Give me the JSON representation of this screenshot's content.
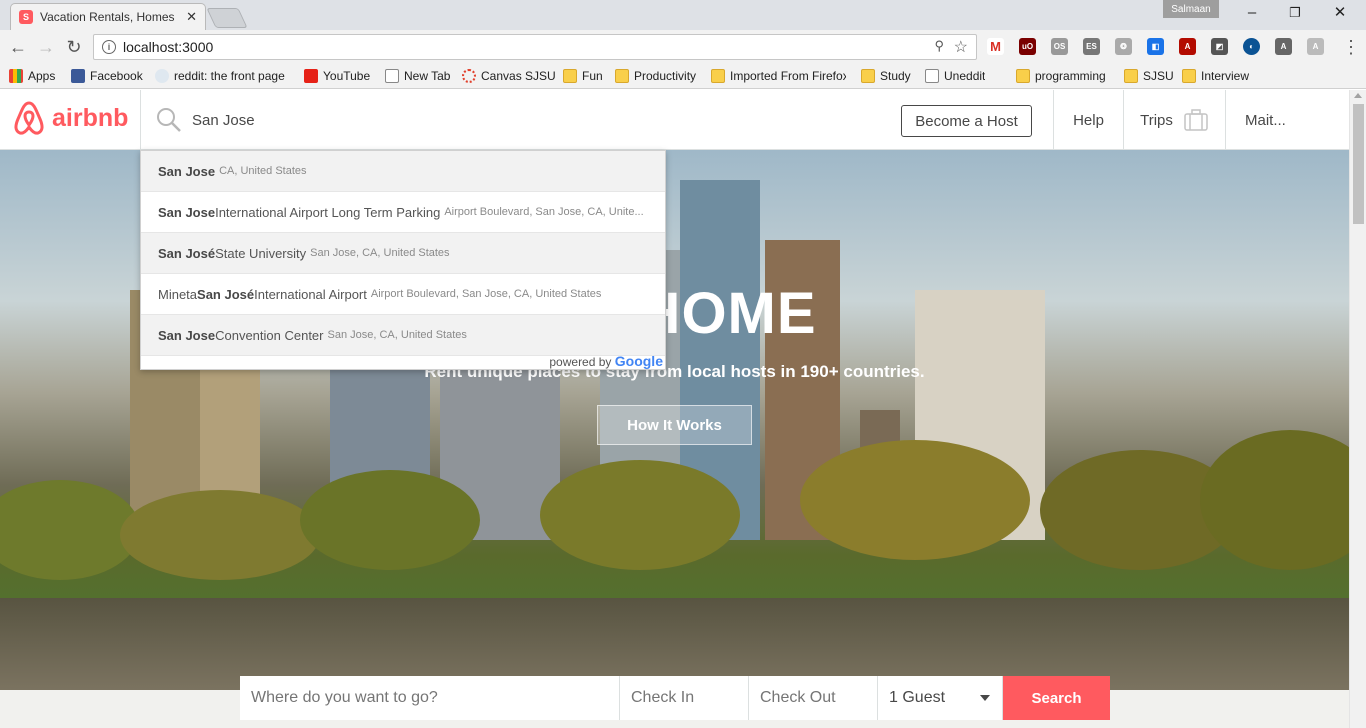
{
  "browser": {
    "tab_title": "Vacation Rentals, Homes",
    "profile_name": "Salmaan",
    "address": "localhost:3000",
    "bookmarks": [
      "Apps",
      "Facebook",
      "reddit: the front page",
      "YouTube",
      "New Tab",
      "Canvas SJSU",
      "Fun",
      "Productivity",
      "Imported From Firefox",
      "Study",
      "Uneddit",
      "programming",
      "SJSU",
      "Interview"
    ]
  },
  "header": {
    "brand": "airbnb",
    "search_value": "San Jose",
    "become_host": "Become a Host",
    "help": "Help",
    "trips": "Trips",
    "user": "Mait..."
  },
  "autocomplete": {
    "suggestions": [
      {
        "bold": "San Jose",
        "pre": "",
        "rest": "",
        "secondary": "CA, United States"
      },
      {
        "bold": "San Jose",
        "pre": "",
        "rest": " International Airport Long Term Parking",
        "secondary": "Airport Boulevard, San Jose, CA, Unite..."
      },
      {
        "bold": "San José",
        "pre": "",
        "rest": " State University",
        "secondary": "San Jose, CA, United States"
      },
      {
        "bold": "San José",
        "pre": "Mineta ",
        "rest": " International Airport",
        "secondary": "Airport Boulevard, San Jose, CA, United States"
      },
      {
        "bold": "San Jose",
        "pre": "",
        "rest": " Convention Center",
        "secondary": "San Jose, CA, United States"
      }
    ],
    "powered_by": "powered by",
    "google": "Google"
  },
  "hero": {
    "title": "ME HOME",
    "subtitle": "Rent unique places to stay from local hosts in 190+ countries.",
    "cta": "How It Works"
  },
  "searchbar": {
    "where_placeholder": "Where do you want to go?",
    "checkin_placeholder": "Check In",
    "checkout_placeholder": "Check Out",
    "guests": "1 Guest",
    "search": "Search"
  },
  "colors": {
    "brand": "#ff5a5f",
    "text": "#484848"
  }
}
